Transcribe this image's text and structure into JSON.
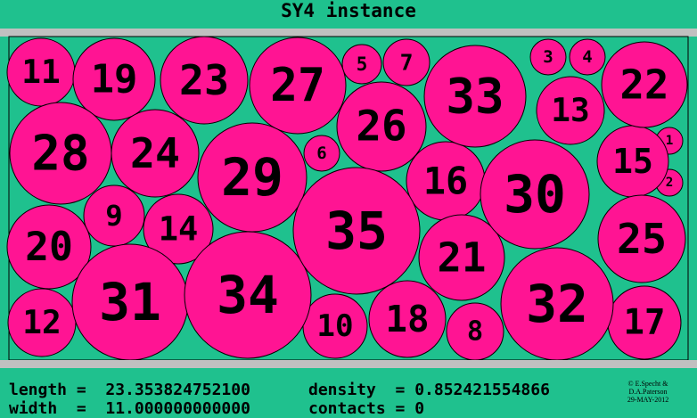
{
  "title": "SY4 instance",
  "stats": {
    "length_line": "length =  23.353824752100",
    "width_line": "width  =  11.000000000000",
    "density_line": "density  = 0.852421554866",
    "contacts_line": "contacts = 0"
  },
  "credit": {
    "line1": "© E.Specht &",
    "line2": "D.A.Paterson",
    "line3": "29-MAY-2012"
  },
  "colors": {
    "background": "#1fc18e",
    "circle_fill": "#ff1493",
    "band": "#c0c0c0"
  },
  "circles": [
    {
      "label": "1"
    },
    {
      "label": "2"
    },
    {
      "label": "3"
    },
    {
      "label": "4"
    },
    {
      "label": "5"
    },
    {
      "label": "6"
    },
    {
      "label": "7"
    },
    {
      "label": "8"
    },
    {
      "label": "9"
    },
    {
      "label": "10"
    },
    {
      "label": "11"
    },
    {
      "label": "12"
    },
    {
      "label": "13"
    },
    {
      "label": "14"
    },
    {
      "label": "15"
    },
    {
      "label": "16"
    },
    {
      "label": "17"
    },
    {
      "label": "18"
    },
    {
      "label": "19"
    },
    {
      "label": "20"
    },
    {
      "label": "21"
    },
    {
      "label": "22"
    },
    {
      "label": "23"
    },
    {
      "label": "24"
    },
    {
      "label": "25"
    },
    {
      "label": "26"
    },
    {
      "label": "27"
    },
    {
      "label": "28"
    },
    {
      "label": "29"
    },
    {
      "label": "30"
    },
    {
      "label": "31"
    },
    {
      "label": "32"
    },
    {
      "label": "33"
    },
    {
      "label": "34"
    },
    {
      "label": "35"
    }
  ]
}
